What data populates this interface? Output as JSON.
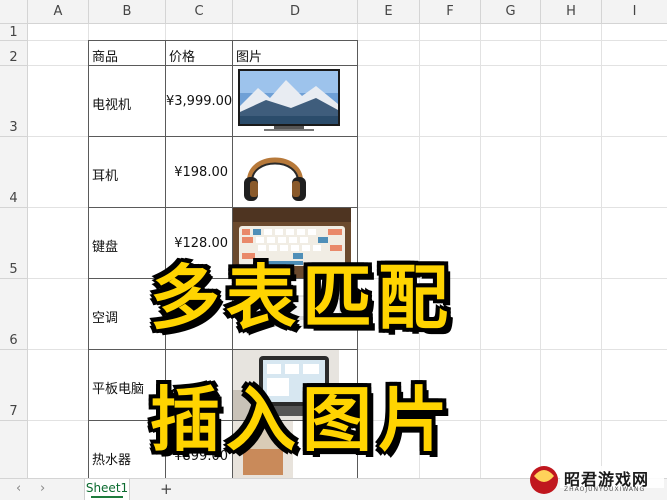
{
  "columns": [
    "A",
    "B",
    "C",
    "D",
    "E",
    "F",
    "G",
    "H",
    "I"
  ],
  "rows": [
    "1",
    "2",
    "3",
    "4",
    "5",
    "6",
    "7"
  ],
  "table": {
    "headers": {
      "product": "商品",
      "price": "价格",
      "image": "图片"
    },
    "items": [
      {
        "name": "电视机",
        "price": "¥3,999.00",
        "image": "tv-image"
      },
      {
        "name": "耳机",
        "price": "¥198.00",
        "image": "headphones-image"
      },
      {
        "name": "键盘",
        "price": "¥128.00",
        "image": "keyboard-image"
      },
      {
        "name": "空调",
        "price": "",
        "image": "air-conditioner-image"
      },
      {
        "name": "平板电脑",
        "price": "",
        "image": "tablet-image"
      },
      {
        "name": "热水器",
        "price": "¥899.00",
        "image": "water-heater-image"
      }
    ]
  },
  "overlay": {
    "line1": "多表匹配",
    "line2": "插入图片"
  },
  "tabs": {
    "sheet1": "Sheet1",
    "add": "+",
    "prev": "‹",
    "next": "›"
  },
  "watermark": {
    "name": "昭君游戏网",
    "domain": "ZHAOJUNYOUXIWANG"
  },
  "colors": {
    "overlay_text": "#ffd400",
    "overlay_outline": "#000000",
    "tab_accent": "#1e7b3c"
  }
}
